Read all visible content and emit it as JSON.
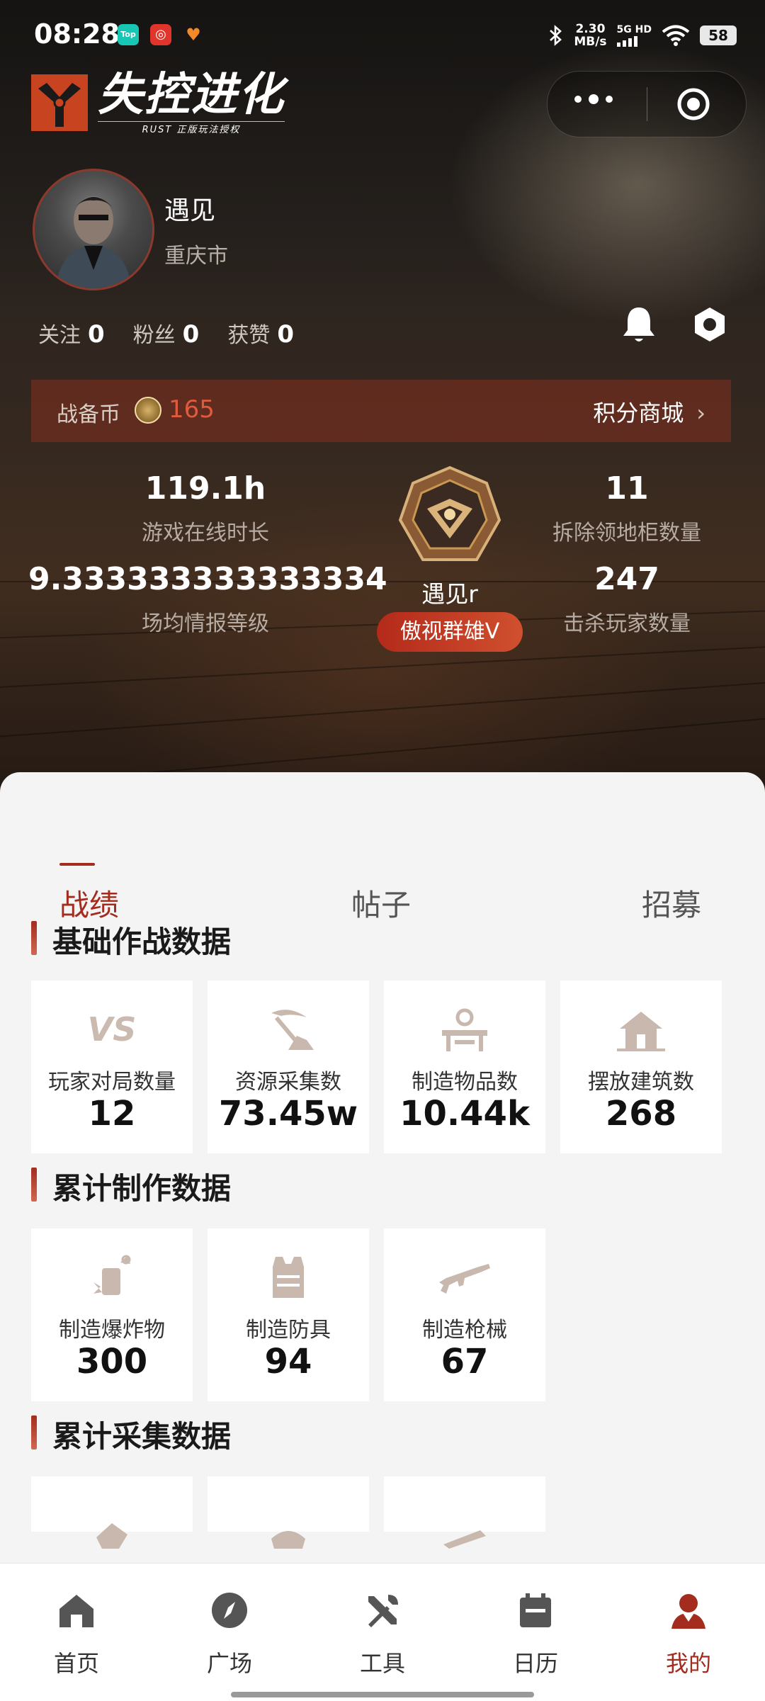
{
  "status_bar": {
    "time": "08:28",
    "apps": [
      "Top",
      "◎",
      "♥"
    ],
    "net_speed_value": "2.30",
    "net_speed_unit": "MB/s",
    "signal_label_1": "5G",
    "signal_label_2": "HD",
    "battery": "58"
  },
  "logo": {
    "title": "失控进化",
    "subtitle": "RUST 正版玩法授权"
  },
  "capsule": {
    "more_icon": "more-dots-icon",
    "close_icon": "target-icon"
  },
  "profile": {
    "nickname": "遇见",
    "city": "重庆市",
    "counts": [
      {
        "label": "关注",
        "value": "0"
      },
      {
        "label": "粉丝",
        "value": "0"
      },
      {
        "label": "获赞",
        "value": "0"
      }
    ]
  },
  "coinbar": {
    "label": "战备币",
    "value": "165",
    "shop_label": "积分商城",
    "chevron": "›"
  },
  "stats": {
    "online_value": "119.1h",
    "online_label": "游戏在线时长",
    "intel_value": "9.333333333333334",
    "intel_label": "场均情报等级",
    "cabinet_value": "11",
    "cabinet_label": "拆除领地柜数量",
    "kills_value": "247",
    "kills_label": "击杀玩家数量",
    "badge_name": "遇见r",
    "rank": "傲视群雄V"
  },
  "tabs": [
    {
      "label": "战绩"
    },
    {
      "label": "帖子"
    },
    {
      "label": "招募"
    }
  ],
  "sections": {
    "basic": {
      "title": "基础作战数据",
      "cards": [
        {
          "label": "玩家对局数量",
          "value": "12",
          "icon": "vs-icon",
          "icon_text": "VS"
        },
        {
          "label": "资源采集数",
          "value": "73.45w",
          "icon": "pickaxe-icon"
        },
        {
          "label": "制造物品数",
          "value": "10.44k",
          "icon": "workbench-icon"
        },
        {
          "label": "摆放建筑数",
          "value": "268",
          "icon": "house-icon"
        }
      ]
    },
    "craft": {
      "title": "累计制作数据",
      "cards": [
        {
          "label": "制造爆炸物",
          "value": "300",
          "icon": "explosive-icon"
        },
        {
          "label": "制造防具",
          "value": "94",
          "icon": "armor-vest-icon"
        },
        {
          "label": "制造枪械",
          "value": "67",
          "icon": "rifle-icon"
        }
      ]
    },
    "gather": {
      "title": "累计采集数据"
    }
  },
  "bottom_nav": [
    {
      "label": "首页",
      "icon": "home-icon"
    },
    {
      "label": "广场",
      "icon": "compass-icon"
    },
    {
      "label": "工具",
      "icon": "tools-icon"
    },
    {
      "label": "日历",
      "icon": "calendar-icon"
    },
    {
      "label": "我的",
      "icon": "user-icon",
      "active": true
    }
  ],
  "colors": {
    "accent": "#a32c1f",
    "coin_value": "#e05a40",
    "icon_tint": "#c9b8ad"
  }
}
